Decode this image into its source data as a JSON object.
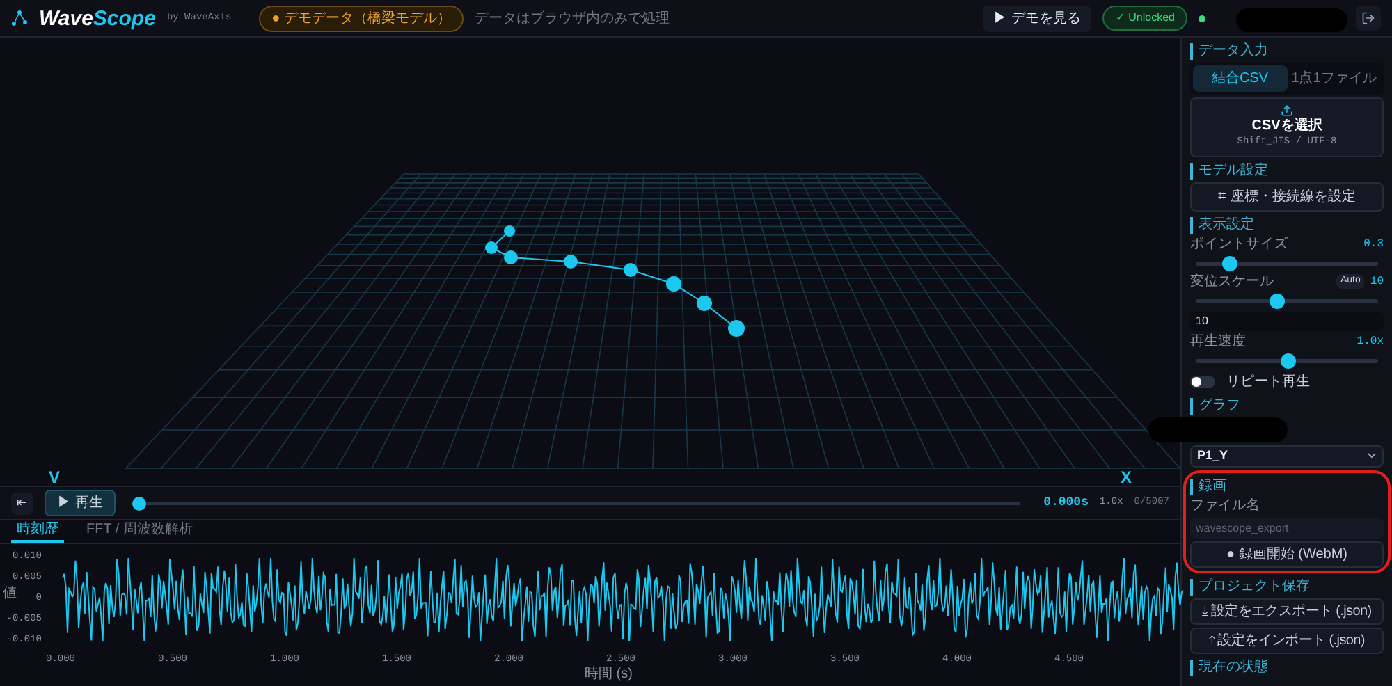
{
  "header": {
    "logo": [
      "Wave",
      "Scope"
    ],
    "byline": "by WaveAxis",
    "demo_badge": "● デモデータ（橋梁モデル）",
    "notice": "データはブラウザ内のみで処理",
    "demo_button": "▶ デモを見る",
    "status_badge": "✓ Unlocked"
  },
  "viewport": {
    "axis_labels": [
      "V",
      "X"
    ]
  },
  "playback": {
    "reset": "⇤",
    "play": "▶ 再生",
    "level": 0,
    "time": "0.000s",
    "speed": "1.0x",
    "frame": "0/5007"
  },
  "chart_tabs": [
    {
      "label": "時刻歴",
      "selected": true
    },
    {
      "label": "FFT / 周波数解析",
      "selected": false
    }
  ],
  "chart": {
    "ylabel": "値",
    "yticks": [
      "0.010",
      "0.005",
      "0",
      "-0.005",
      "-0.010"
    ],
    "xticks": [
      "0.000",
      "0.500",
      "1.000",
      "1.500",
      "2.000",
      "2.500",
      "3.000",
      "3.500",
      "4.000",
      "4.500"
    ],
    "xlabel": "時間 (s)"
  },
  "sidebar": {
    "data_input": {
      "title": "データ入力",
      "tabs": [
        {
          "label": "結合CSV",
          "selected": true
        },
        {
          "label": "1点1ファイル",
          "selected": false
        }
      ],
      "upload_title": "CSVを選択",
      "upload_hint": "Shift_JIS / UTF-8"
    },
    "model": {
      "title": "モデル設定",
      "button": "⌗ 座標・接続線を設定"
    },
    "display": {
      "title": "表示設定",
      "point_size": {
        "label": "ポイントサイズ",
        "reading": "0.3",
        "level": 0.18
      },
      "scale": {
        "label": "変位スケール",
        "auto": "Auto",
        "reading": "10",
        "level": 0.44,
        "value": "10"
      },
      "speed": {
        "label": "再生速度",
        "reading": "1.0x",
        "level": 0.5
      },
      "repeat": {
        "label": "リピート再生",
        "on": false
      }
    },
    "graph": {
      "title": "グラフ",
      "select": "P1_Y"
    },
    "record": {
      "title": "録画",
      "file_label": "ファイル名",
      "placeholder": "wavescope_export",
      "button": "● 録画開始 (WebM)"
    },
    "project": {
      "title": "プロジェクト保存",
      "export": "⤓ 設定をエクスポート (.json)",
      "import": "⤒ 設定をインポート (.json)"
    },
    "state": {
      "title": "現在の状態"
    }
  }
}
